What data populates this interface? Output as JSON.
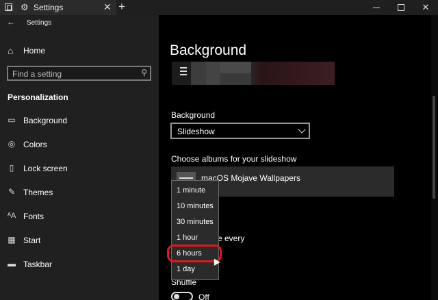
{
  "window": {
    "tab_title": "Settings",
    "app_title": "Settings",
    "close_tab_glyph": "✕",
    "new_tab_glyph": "+",
    "close_glyph": "✕"
  },
  "sidebar": {
    "home_label": "Home",
    "search_placeholder": "Find a setting",
    "section_title": "Personalization",
    "items": [
      {
        "label": "Background",
        "icon": "picture-icon"
      },
      {
        "label": "Colors",
        "icon": "palette-icon"
      },
      {
        "label": "Lock screen",
        "icon": "lock-screen-icon"
      },
      {
        "label": "Themes",
        "icon": "brush-icon"
      },
      {
        "label": "Fonts",
        "icon": "font-icon"
      },
      {
        "label": "Start",
        "icon": "start-icon"
      },
      {
        "label": "Taskbar",
        "icon": "taskbar-icon"
      }
    ]
  },
  "main": {
    "title": "Background",
    "background_label": "Background",
    "background_value": "Slideshow",
    "albums_label": "Choose albums for your slideshow",
    "album_name": "macOS Mojave Wallpapers",
    "change_every_partial": "e every",
    "shuffle_label": "Shuffle",
    "shuffle_state": "Off"
  },
  "dropdown": {
    "options": [
      "1 minute",
      "10 minutes",
      "30 minutes",
      "1 hour",
      "6 hours",
      "1 day"
    ],
    "highlighted": "6 hours"
  },
  "colors": {
    "highlight_ring": "#e8161c",
    "sidebar_bg": "#202020",
    "main_bg": "#000000"
  }
}
